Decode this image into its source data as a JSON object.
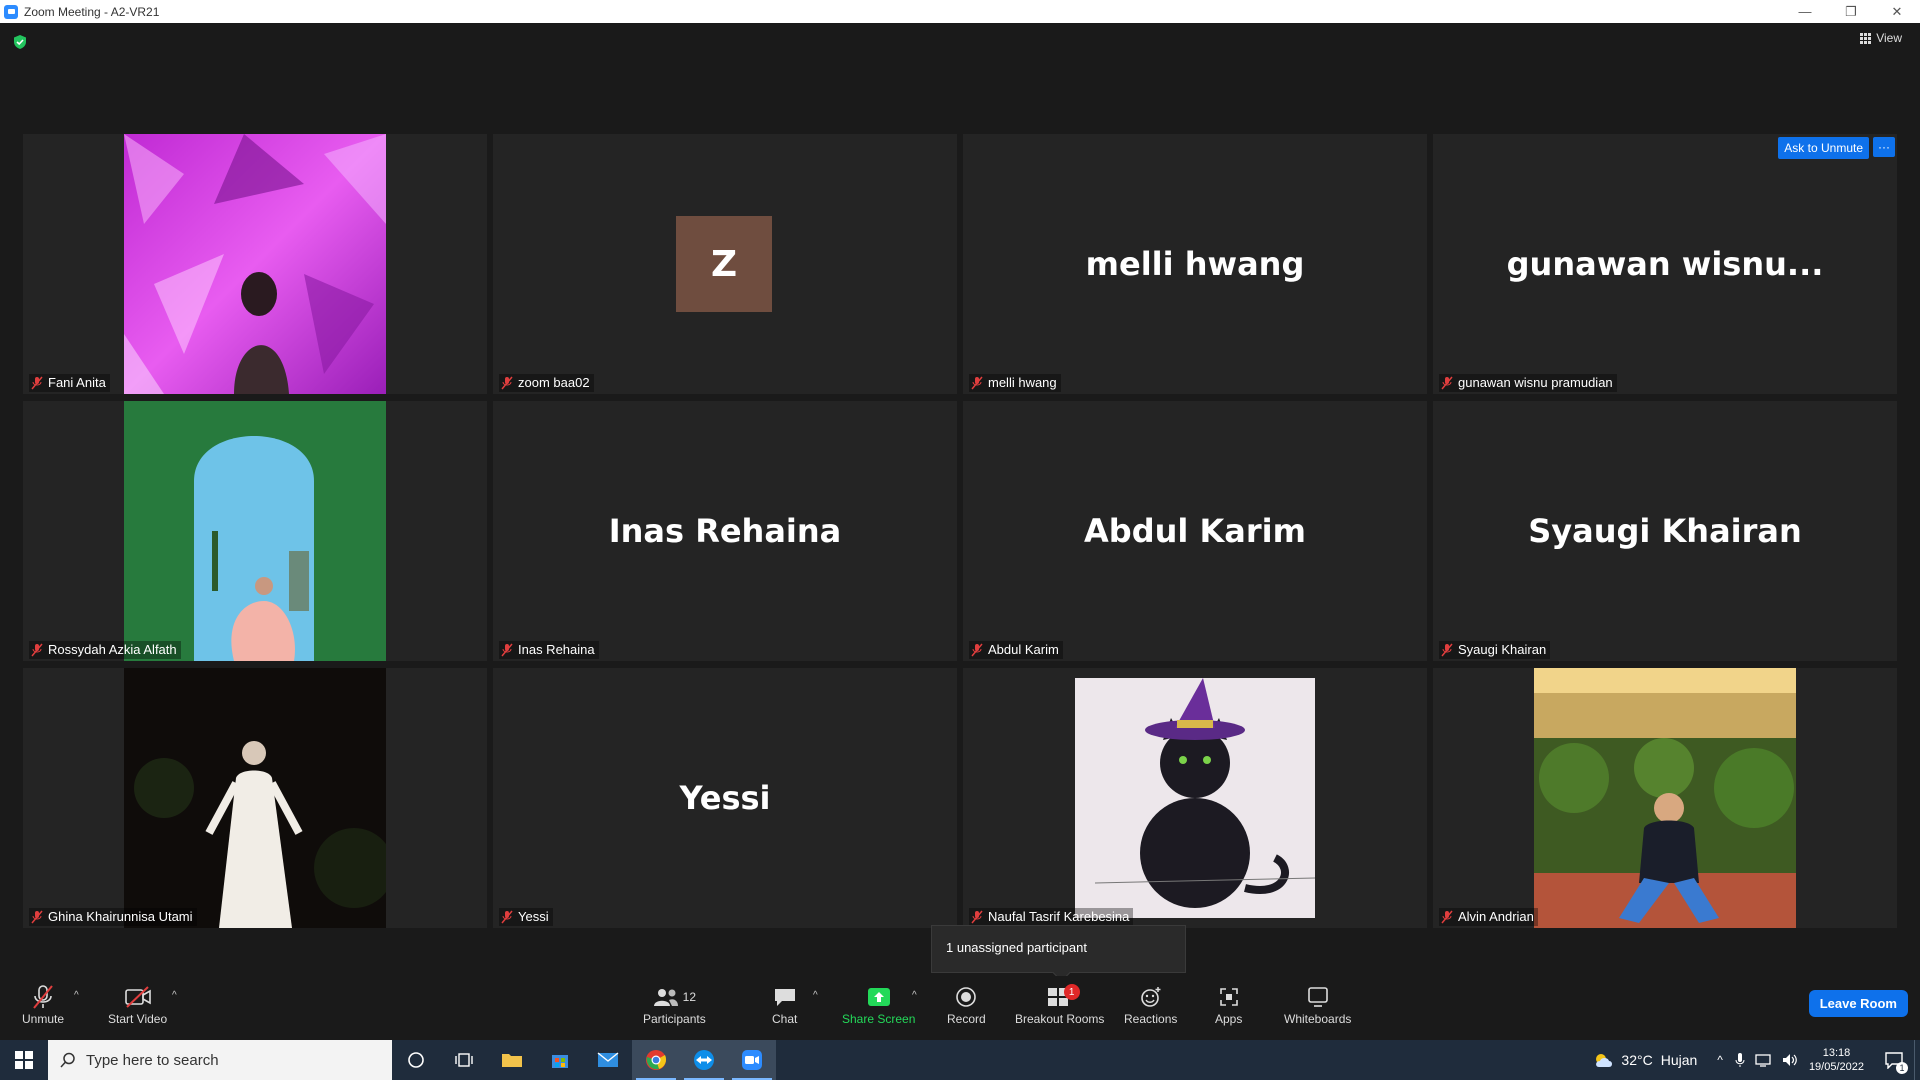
{
  "window": {
    "title": "Zoom Meeting - A2-VR21"
  },
  "header": {
    "view_label": "View"
  },
  "tiles": [
    {
      "name": "Fani Anita"
    },
    {
      "name": "zoom baa02",
      "avatar_letter": "Z"
    },
    {
      "name": "melli hwang",
      "display": "melli hwang"
    },
    {
      "name": "gunawan wisnu pramudian",
      "display": "gunawan  wisnu...",
      "ask_unmute": "Ask to Unmute",
      "more": "···"
    },
    {
      "name": "Rossydah Azkia Alfath"
    },
    {
      "name": "Inas Rehaina",
      "display": "Inas Rehaina"
    },
    {
      "name": "Abdul Karim",
      "display": "Abdul Karim"
    },
    {
      "name": "Syaugi Khairan",
      "display": "Syaugi Khairan"
    },
    {
      "name": "Ghina Khairunnisa Utami"
    },
    {
      "name": "Yessi",
      "display": "Yessi"
    },
    {
      "name": "Naufal Tasrif Karebesina"
    },
    {
      "name": "Alvin Andrian"
    }
  ],
  "tooltip": {
    "text": "1 unassigned participant"
  },
  "toolbar": {
    "unmute": "Unmute",
    "start_video": "Start Video",
    "participants": "Participants",
    "participants_count": "12",
    "chat": "Chat",
    "share_screen": "Share Screen",
    "record": "Record",
    "breakout_rooms": "Breakout Rooms",
    "breakout_badge": "1",
    "reactions": "Reactions",
    "apps": "Apps",
    "whiteboards": "Whiteboards",
    "leave": "Leave Room"
  },
  "taskbar": {
    "search_placeholder": "Type here to search",
    "weather_temp": "32°C",
    "weather_desc": "Hujan",
    "time": "13:18",
    "date": "19/05/2022",
    "notification_count": "1"
  },
  "colors": {
    "accent": "#0e71eb",
    "share_green": "#23d959",
    "badge_red": "#e02828"
  }
}
